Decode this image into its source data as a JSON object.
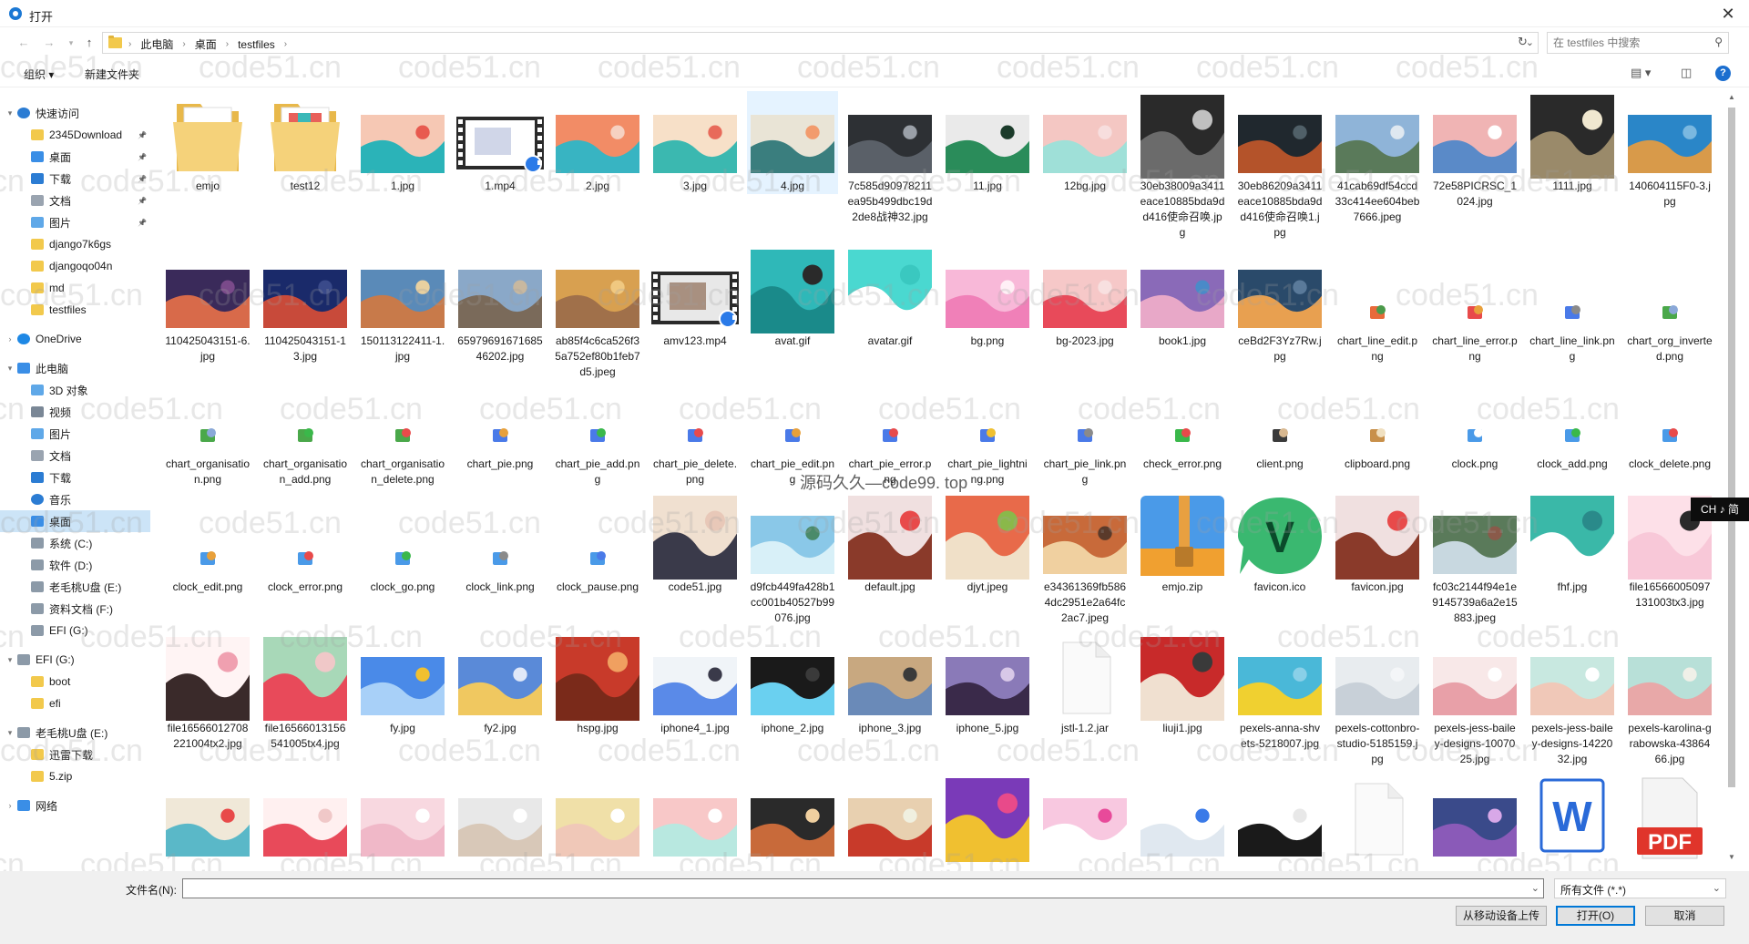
{
  "window": {
    "title": "打开",
    "close_symbol": "✕"
  },
  "address": {
    "crumbs": [
      "此电脑",
      "桌面",
      "testfiles"
    ],
    "search_placeholder": "在 testfiles 中搜索"
  },
  "toolbar": {
    "organize": "组织 ▾",
    "new_folder": "新建文件夹"
  },
  "sidebar": [
    {
      "label": "快速访问",
      "indent": 0,
      "icon": "star-icon",
      "color": "#2b7cd3",
      "chev": "▾"
    },
    {
      "label": "2345Download",
      "indent": 1,
      "icon": "folder-icon",
      "color": "#f2c94c",
      "pin": true
    },
    {
      "label": "桌面",
      "indent": 1,
      "icon": "desktop-icon",
      "color": "#3a8ee6",
      "pin": true
    },
    {
      "label": "下载",
      "indent": 1,
      "icon": "download-icon",
      "color": "#2b7cd3",
      "pin": true
    },
    {
      "label": "文档",
      "indent": 1,
      "icon": "document-icon",
      "color": "#9aa4b0",
      "pin": true
    },
    {
      "label": "图片",
      "indent": 1,
      "icon": "pictures-icon",
      "color": "#5fa8e8",
      "pin": true
    },
    {
      "label": "django7k6gs",
      "indent": 1,
      "icon": "folder-icon",
      "color": "#f2c94c"
    },
    {
      "label": "djangoqo04n",
      "indent": 1,
      "icon": "folder-icon",
      "color": "#f2c94c"
    },
    {
      "label": "md",
      "indent": 1,
      "icon": "folder-icon",
      "color": "#f2c94c"
    },
    {
      "label": "testfiles",
      "indent": 1,
      "icon": "folder-icon",
      "color": "#f2c94c"
    },
    {
      "gap": true
    },
    {
      "label": "OneDrive",
      "indent": 0,
      "icon": "cloud-icon",
      "color": "#1e88e5",
      "chev": "›"
    },
    {
      "gap": true
    },
    {
      "label": "此电脑",
      "indent": 0,
      "icon": "computer-icon",
      "color": "#3a8ee6",
      "chev": "▾"
    },
    {
      "label": "3D 对象",
      "indent": 1,
      "icon": "cube-icon",
      "color": "#5fa8e8"
    },
    {
      "label": "视频",
      "indent": 1,
      "icon": "video-icon",
      "color": "#7a8796"
    },
    {
      "label": "图片",
      "indent": 1,
      "icon": "pictures-icon",
      "color": "#5fa8e8"
    },
    {
      "label": "文档",
      "indent": 1,
      "icon": "document-icon",
      "color": "#9aa4b0"
    },
    {
      "label": "下载",
      "indent": 1,
      "icon": "download-icon",
      "color": "#2b7cd3"
    },
    {
      "label": "音乐",
      "indent": 1,
      "icon": "music-icon",
      "color": "#2b7cd3"
    },
    {
      "label": "桌面",
      "indent": 1,
      "icon": "desktop-icon",
      "color": "#3a8ee6",
      "selected": true
    },
    {
      "label": "系统 (C:)",
      "indent": 1,
      "icon": "drive-icon",
      "color": "#8c9aa8"
    },
    {
      "label": "软件 (D:)",
      "indent": 1,
      "icon": "drive-icon",
      "color": "#8c9aa8"
    },
    {
      "label": "老毛桃U盘 (E:)",
      "indent": 1,
      "icon": "usb-drive-icon",
      "color": "#8c9aa8"
    },
    {
      "label": "资料文档 (F:)",
      "indent": 1,
      "icon": "drive-icon",
      "color": "#8c9aa8"
    },
    {
      "label": "EFI (G:)",
      "indent": 1,
      "icon": "drive-icon",
      "color": "#8c9aa8"
    },
    {
      "gap": true
    },
    {
      "label": "EFI (G:)",
      "indent": 0,
      "icon": "drive-icon",
      "color": "#8c9aa8",
      "chev": "▾"
    },
    {
      "label": "boot",
      "indent": 1,
      "icon": "folder-icon",
      "color": "#f2c94c"
    },
    {
      "label": "efi",
      "indent": 1,
      "icon": "folder-icon",
      "color": "#f2c94c"
    },
    {
      "gap": true
    },
    {
      "label": "老毛桃U盘 (E:)",
      "indent": 0,
      "icon": "usb-drive-icon",
      "color": "#8c9aa8",
      "chev": "▾"
    },
    {
      "label": "迅雷下载",
      "indent": 1,
      "icon": "folder-icon",
      "color": "#f2c94c"
    },
    {
      "label": "5.zip",
      "indent": 1,
      "icon": "zip-icon",
      "color": "#f2c94c"
    },
    {
      "gap": true
    },
    {
      "label": "网络",
      "indent": 0,
      "icon": "network-icon",
      "color": "#3a8ee6",
      "chev": "›"
    }
  ],
  "rows": [
    [
      {
        "name": "emjo",
        "kind": "folder"
      },
      {
        "name": "test12",
        "kind": "folder2"
      },
      {
        "name": "1.jpg",
        "kind": "img",
        "colors": [
          "#f6c8b4",
          "#2bb3b8",
          "#e85a4f"
        ]
      },
      {
        "name": "1.mp4",
        "kind": "video",
        "colors": [
          "#ffffff",
          "#d0d6e8",
          "#e45a5a"
        ]
      },
      {
        "name": "2.jpg",
        "kind": "img",
        "colors": [
          "#f28c66",
          "#38b4c2",
          "#f6d1c1"
        ]
      },
      {
        "name": "3.jpg",
        "kind": "img",
        "colors": [
          "#f7e0c8",
          "#3bb8b0",
          "#e86a5a"
        ]
      },
      {
        "name": "4.jpg",
        "kind": "img",
        "colors": [
          "#e9e4d6",
          "#3a7e7e",
          "#f29b6d"
        ],
        "hover": true
      },
      {
        "name": "7c585d90978211ea95b499dbc19d2de8战神32.jpg",
        "kind": "img",
        "colors": [
          "#2d3034",
          "#5a6068",
          "#9aa0a8"
        ]
      },
      {
        "name": "11.jpg",
        "kind": "img",
        "colors": [
          "#eaeaea",
          "#2a8c5a",
          "#1b3b2a"
        ]
      },
      {
        "name": "12bg.jpg",
        "kind": "img",
        "colors": [
          "#f4c7c3",
          "#9fe0d8",
          "#f7dede"
        ]
      },
      {
        "name": "30eb38009a3411eace10885bda9dd416使命召唤.jpg",
        "kind": "img",
        "colors": [
          "#2a2a2a",
          "#6b6b6b",
          "#c0c0c0"
        ],
        "tall": true
      },
      {
        "name": "30eb86209a3411eace10885bda9dd416使命召唤1.jpg",
        "kind": "img",
        "colors": [
          "#20282e",
          "#b4532a",
          "#506068"
        ]
      },
      {
        "name": "41cab69df54ccd33c414ee604beb7666.jpeg",
        "kind": "img",
        "colors": [
          "#8fb4d8",
          "#5a7a5a",
          "#dfe8f0"
        ]
      },
      {
        "name": "72e58PICRSC_1024.jpg",
        "kind": "img",
        "colors": [
          "#f0b4b4",
          "#5a8ac8",
          "#ffffff"
        ]
      },
      {
        "name": "1111.jpg",
        "kind": "img",
        "colors": [
          "#2a2a2a",
          "#9a8a6a",
          "#f0e8d0"
        ],
        "tall": true
      },
      {
        "name": "140604115F0-3.jpg",
        "kind": "img",
        "colors": [
          "#2a86c8",
          "#d89a4a",
          "#7ab8e0"
        ]
      }
    ],
    [
      {
        "name": "110425043151-6.jpg",
        "kind": "img",
        "colors": [
          "#3a2a5a",
          "#d86a4a",
          "#7a4a8a"
        ]
      },
      {
        "name": "110425043151-13.jpg",
        "kind": "img",
        "colors": [
          "#1a2a6a",
          "#c84a3a",
          "#3a4a8a"
        ]
      },
      {
        "name": "150113122411-1.jpg",
        "kind": "img",
        "colors": [
          "#5a8ab8",
          "#c87a4a",
          "#e8d0a0"
        ]
      },
      {
        "name": "6597969167168546202.jpg",
        "kind": "img",
        "colors": [
          "#8aa8c8",
          "#7a6a5a",
          "#c8b8a0"
        ]
      },
      {
        "name": "ab85f4c6ca526f35a752ef80b1feb7d5.jpeg",
        "kind": "img",
        "colors": [
          "#d8a050",
          "#a0704a",
          "#f0c880"
        ]
      },
      {
        "name": "amv123.mp4",
        "kind": "video",
        "colors": [
          "#e8e8e8",
          "#a89080",
          "#3a3a3a"
        ]
      },
      {
        "name": "avat.gif",
        "kind": "img",
        "colors": [
          "#2fb8b8",
          "#1a8a8a",
          "#2a2a2a"
        ],
        "tall": true
      },
      {
        "name": "avatar.gif",
        "kind": "img",
        "colors": [
          "#4ad8d0",
          "#ffffff",
          "#3ac8c0"
        ],
        "tall": true
      },
      {
        "name": "bg.png",
        "kind": "img",
        "colors": [
          "#f8b8d8",
          "#f080b8",
          "#fff0f6"
        ]
      },
      {
        "name": "bg-2023.jpg",
        "kind": "img",
        "colors": [
          "#f6c8c8",
          "#e84a5a",
          "#f8e0e0"
        ]
      },
      {
        "name": "book1.jpg",
        "kind": "img",
        "colors": [
          "#8a6ab8",
          "#e8a8c8",
          "#4a8ac8"
        ]
      },
      {
        "name": "ceBd2F3Yz7Rw.jpg",
        "kind": "img",
        "colors": [
          "#2a4a6a",
          "#e8a050",
          "#5a7a9a"
        ]
      },
      {
        "name": "chart_line_edit.png",
        "kind": "icon",
        "colors": [
          "#e86a3a",
          "#4a9a4a"
        ]
      },
      {
        "name": "chart_line_error.png",
        "kind": "icon",
        "colors": [
          "#e84a4a",
          "#e8a03a"
        ]
      },
      {
        "name": "chart_line_link.png",
        "kind": "icon",
        "colors": [
          "#4a7ae8",
          "#8a8a8a"
        ]
      },
      {
        "name": "chart_org_inverted.png",
        "kind": "icon",
        "colors": [
          "#4aa84a",
          "#8aa8d8"
        ]
      }
    ],
    [
      {
        "name": "chart_organisation.png",
        "kind": "icon",
        "colors": [
          "#4aa84a",
          "#8aa8d8"
        ]
      },
      {
        "name": "chart_organisation_add.png",
        "kind": "icon",
        "colors": [
          "#4aa84a",
          "#3ab84a"
        ]
      },
      {
        "name": "chart_organisation_delete.png",
        "kind": "icon",
        "colors": [
          "#4aa84a",
          "#e84a4a"
        ]
      },
      {
        "name": "chart_pie.png",
        "kind": "icon",
        "colors": [
          "#4a7ae8",
          "#e8a03a"
        ]
      },
      {
        "name": "chart_pie_add.png",
        "kind": "icon",
        "colors": [
          "#4a7ae8",
          "#3ab84a"
        ]
      },
      {
        "name": "chart_pie_delete.png",
        "kind": "icon",
        "colors": [
          "#4a7ae8",
          "#e84a4a"
        ]
      },
      {
        "name": "chart_pie_edit.png",
        "kind": "icon",
        "colors": [
          "#4a7ae8",
          "#e8a03a"
        ]
      },
      {
        "name": "chart_pie_error.png",
        "kind": "icon",
        "colors": [
          "#4a7ae8",
          "#e84a4a"
        ]
      },
      {
        "name": "chart_pie_lightning.png",
        "kind": "icon",
        "colors": [
          "#4a7ae8",
          "#f0c030"
        ]
      },
      {
        "name": "chart_pie_link.png",
        "kind": "icon",
        "colors": [
          "#4a7ae8",
          "#8a8a8a"
        ]
      },
      {
        "name": "check_error.png",
        "kind": "icon",
        "colors": [
          "#3ab84a",
          "#e84a4a"
        ]
      },
      {
        "name": "client.png",
        "kind": "icon",
        "colors": [
          "#3a3a3a",
          "#d8b890"
        ]
      },
      {
        "name": "clipboard.png",
        "kind": "icon",
        "colors": [
          "#c8904a",
          "#f0e0c0"
        ]
      },
      {
        "name": "clock.png",
        "kind": "icon",
        "colors": [
          "#4a9ae8",
          "#ffffff"
        ]
      },
      {
        "name": "clock_add.png",
        "kind": "icon",
        "colors": [
          "#4a9ae8",
          "#3ab84a"
        ]
      },
      {
        "name": "clock_delete.png",
        "kind": "icon",
        "colors": [
          "#4a9ae8",
          "#e84a4a"
        ]
      }
    ],
    [
      {
        "name": "clock_edit.png",
        "kind": "icon",
        "colors": [
          "#4a9ae8",
          "#e8a03a"
        ]
      },
      {
        "name": "clock_error.png",
        "kind": "icon",
        "colors": [
          "#4a9ae8",
          "#e84a4a"
        ]
      },
      {
        "name": "clock_go.png",
        "kind": "icon",
        "colors": [
          "#4a9ae8",
          "#3ab84a"
        ]
      },
      {
        "name": "clock_link.png",
        "kind": "icon",
        "colors": [
          "#4a9ae8",
          "#8a8a8a"
        ]
      },
      {
        "name": "clock_pause.png",
        "kind": "icon",
        "colors": [
          "#4a9ae8",
          "#4a7ae8"
        ]
      },
      {
        "name": "code51.jpg",
        "kind": "img",
        "colors": [
          "#f0e0d0",
          "#3a3a4a",
          "#e8c8b8"
        ],
        "tall": true
      },
      {
        "name": "d9fcb449fa428b1cc001b40527b99076.jpg",
        "kind": "img",
        "colors": [
          "#8ac8e8",
          "#d8f0f8",
          "#4a8a6a"
        ]
      },
      {
        "name": "default.jpg",
        "kind": "img",
        "colors": [
          "#f0e0e0",
          "#8a3a2a",
          "#e84a4a"
        ],
        "tall": true
      },
      {
        "name": "djyt.jpeg",
        "kind": "img",
        "colors": [
          "#e86a4a",
          "#f0e0c8",
          "#8ab84a"
        ],
        "tall": true
      },
      {
        "name": "e34361369fb5864dc2951e2a64fc2ac7.jpeg",
        "kind": "img",
        "colors": [
          "#c86a3a",
          "#f0d0a0",
          "#5a3a2a"
        ]
      },
      {
        "name": "emjo.zip",
        "kind": "zip",
        "colors": [
          "#4a9ae8",
          "#f0b030"
        ]
      },
      {
        "name": "favicon.ico",
        "kind": "fav",
        "colors": [
          "#3ab870",
          "#ffffff"
        ]
      },
      {
        "name": "favicon.jpg",
        "kind": "img",
        "colors": [
          "#f0e0e0",
          "#8a3a2a",
          "#e84a4a"
        ],
        "tall": true
      },
      {
        "name": "fc03c2144f94e1e9145739a6a2e15883.jpeg",
        "kind": "img",
        "colors": [
          "#5a7a5a",
          "#c8d8e0",
          "#8a5a4a"
        ]
      },
      {
        "name": "fhf.jpg",
        "kind": "img",
        "colors": [
          "#3ab8a8",
          "#ffffff",
          "#2a8a8a"
        ],
        "tall": true
      },
      {
        "name": "file16566005097131003tx3.jpg",
        "kind": "img",
        "colors": [
          "#fde0e8",
          "#f8c8d8",
          "#2a2a2a"
        ],
        "tall": true
      }
    ],
    [
      {
        "name": "file16566012708221004tx2.jpg",
        "kind": "img",
        "colors": [
          "#fff4f4",
          "#3a2a2a",
          "#f0a0b0"
        ],
        "tall": true
      },
      {
        "name": "file16566013156541005tx4.jpg",
        "kind": "img",
        "colors": [
          "#a8d8b8",
          "#e84a5a",
          "#f0c8c8"
        ],
        "tall": true
      },
      {
        "name": "fy.jpg",
        "kind": "img",
        "colors": [
          "#4a8ae8",
          "#a8d0f8",
          "#f0c030"
        ]
      },
      {
        "name": "fy2.jpg",
        "kind": "img",
        "colors": [
          "#5a8ad8",
          "#f0c860",
          "#e0e8f8"
        ]
      },
      {
        "name": "hspg.jpg",
        "kind": "img",
        "colors": [
          "#c83a2a",
          "#7a2a1a",
          "#f0a060"
        ],
        "tall": true
      },
      {
        "name": "iphone4_1.jpg",
        "kind": "img",
        "colors": [
          "#f0f4f8",
          "#5a8ae8",
          "#3a3a4a"
        ]
      },
      {
        "name": "iphone_2.jpg",
        "kind": "img",
        "colors": [
          "#1a1a1a",
          "#6ad0f0",
          "#3a3a3a"
        ]
      },
      {
        "name": "iphone_3.jpg",
        "kind": "img",
        "colors": [
          "#c8a880",
          "#6a8ab8",
          "#3a3a3a"
        ]
      },
      {
        "name": "iphone_5.jpg",
        "kind": "img",
        "colors": [
          "#8a7ab8",
          "#3a2a4a",
          "#d8c8e8"
        ]
      },
      {
        "name": "jstl-1.2.jar",
        "kind": "blank"
      },
      {
        "name": "liuji1.jpg",
        "kind": "img",
        "colors": [
          "#c82a2a",
          "#f0e0d0",
          "#3a3a3a"
        ],
        "tall": true
      },
      {
        "name": "pexels-anna-shvets-5218007.jpg",
        "kind": "img",
        "colors": [
          "#4ab8d8",
          "#f0d030",
          "#8ad0e8"
        ]
      },
      {
        "name": "pexels-cottonbro-studio-5185159.jpg",
        "kind": "img",
        "colors": [
          "#e8ecef",
          "#c8d0d8",
          "#f4f6f8"
        ]
      },
      {
        "name": "pexels-jess-bailey-designs-1007025.jpg",
        "kind": "img",
        "colors": [
          "#f8e8e8",
          "#e8a0a8",
          "#ffffff"
        ]
      },
      {
        "name": "pexels-jess-bailey-designs-1422032.jpg",
        "kind": "img",
        "colors": [
          "#c8e8e0",
          "#f0c8b8",
          "#ffffff"
        ]
      },
      {
        "name": "pexels-karolina-grabowska-4386466.jpg",
        "kind": "img",
        "colors": [
          "#b8e0d8",
          "#e8a8a8",
          "#f0f0e8"
        ]
      }
    ],
    [
      {
        "name": "",
        "kind": "img",
        "colors": [
          "#f0e8d8",
          "#5ab8c8",
          "#e84a4a"
        ]
      },
      {
        "name": "",
        "kind": "img",
        "colors": [
          "#fff0f0",
          "#e84a5a",
          "#f0c8c8"
        ]
      },
      {
        "name": "",
        "kind": "img",
        "colors": [
          "#f8d8e0",
          "#f0b8c8",
          "#ffffff"
        ]
      },
      {
        "name": "",
        "kind": "img",
        "colors": [
          "#e8e8e8",
          "#d8c8b8",
          "#ffffff"
        ]
      },
      {
        "name": "",
        "kind": "img",
        "colors": [
          "#f0e0a8",
          "#f0c8b8",
          "#ffffff"
        ]
      },
      {
        "name": "",
        "kind": "img",
        "colors": [
          "#f8c8c8",
          "#b8e8e0",
          "#ffffff"
        ]
      },
      {
        "name": "",
        "kind": "img",
        "colors": [
          "#2a2a2a",
          "#c86a3a",
          "#f0d0a0"
        ]
      },
      {
        "name": "",
        "kind": "img",
        "colors": [
          "#e8d0b0",
          "#c83a2a",
          "#f0f0e0"
        ]
      },
      {
        "name": "",
        "kind": "img",
        "colors": [
          "#7a3ab8",
          "#f0c030",
          "#e84a8a"
        ],
        "tall": true
      },
      {
        "name": "",
        "kind": "img",
        "colors": [
          "#f8c8e0",
          "#ffffff",
          "#e84a9a"
        ]
      },
      {
        "name": "",
        "kind": "img",
        "colors": [
          "#ffffff",
          "#e0e8f0",
          "#3a7ae8"
        ]
      },
      {
        "name": "",
        "kind": "img",
        "colors": [
          "#ffffff",
          "#1a1a1a",
          "#e8e8e8"
        ]
      },
      {
        "name": "",
        "kind": "blank"
      },
      {
        "name": "",
        "kind": "img",
        "colors": [
          "#3a4a8a",
          "#8a5ab8",
          "#d8a8e8"
        ]
      },
      {
        "name": "",
        "kind": "word"
      },
      {
        "name": "",
        "kind": "pdf"
      }
    ]
  ],
  "bottom": {
    "filename_label": "文件名(N):",
    "filename_value": "",
    "filter": "所有文件 (*.*)",
    "upload_button": "从移动设备上传",
    "open_button": "打开(O)",
    "cancel_button": "取消"
  },
  "ime": "CH ♪ 简",
  "watermark": "code51.cn",
  "watermark2": "源码久久—code99. top",
  "colors": {
    "accent": "#0078d7",
    "selected_nav": "#cce4f7",
    "hover_item": "#e5f3ff"
  }
}
